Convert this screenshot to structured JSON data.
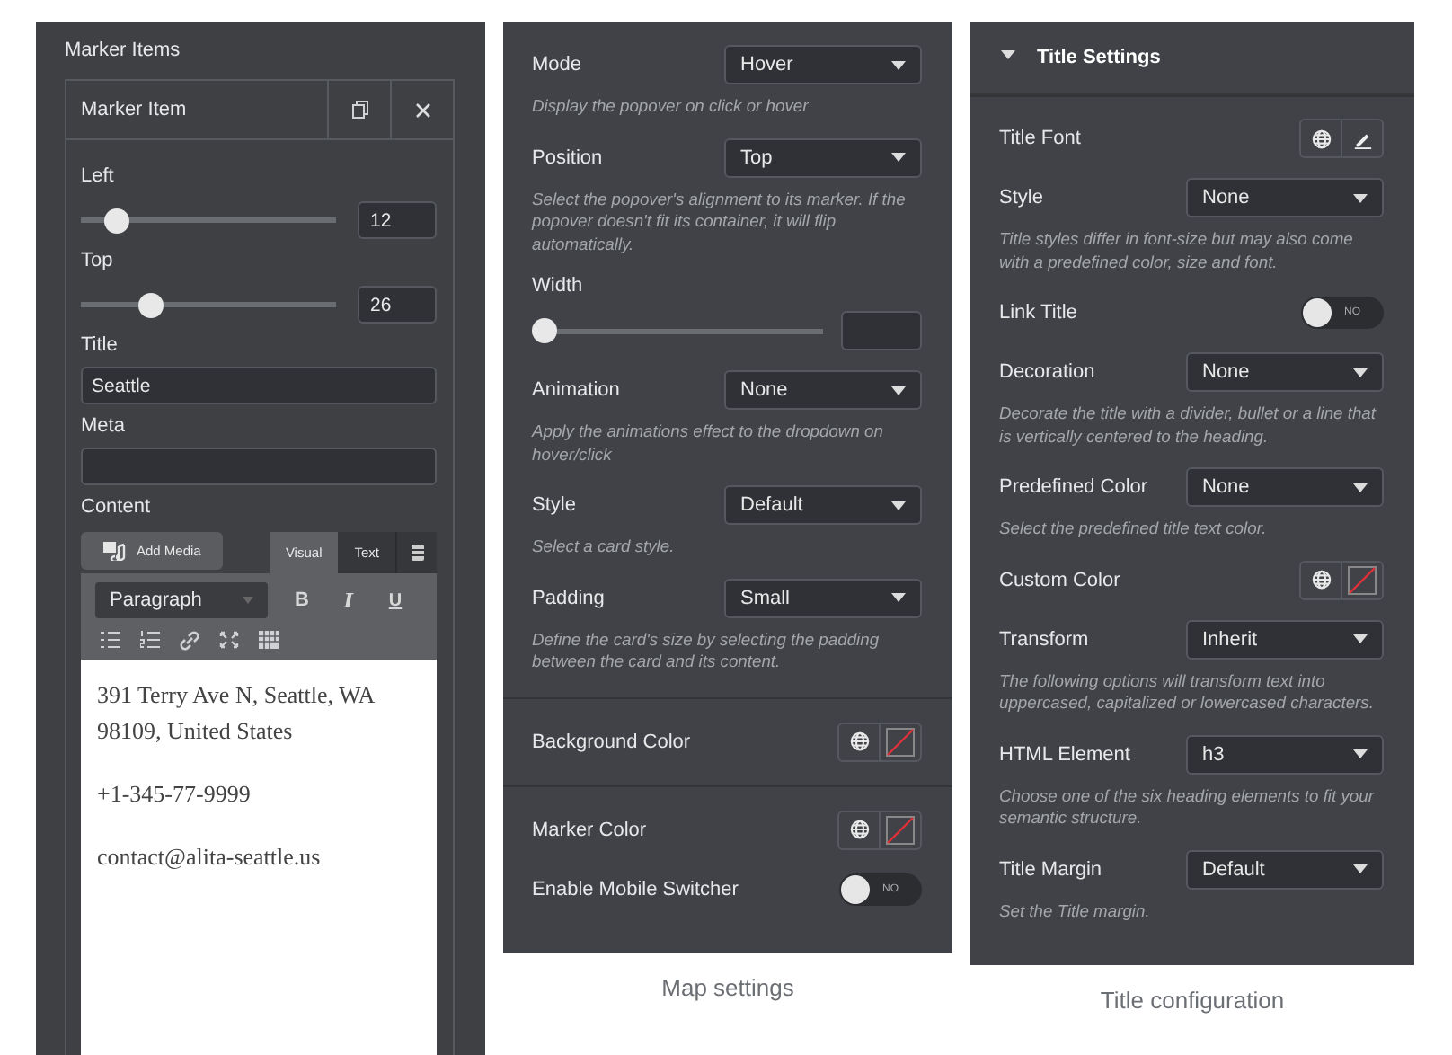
{
  "marker_items": {
    "heading": "Marker Items",
    "item": {
      "title": "Marker Item",
      "fields": [
        {
          "kind": "slider",
          "label": "Left",
          "level": 0.1,
          "value": "12"
        },
        {
          "kind": "slider",
          "label": "Top",
          "level": 0.25,
          "value": "26"
        },
        {
          "kind": "text",
          "label": "Title",
          "value": "Seattle"
        },
        {
          "kind": "text",
          "label": "Meta"
        }
      ],
      "content": {
        "label": "Content",
        "add_media": "Add Media",
        "tabs": [
          {
            "label": "Visual",
            "selected": true
          },
          {
            "label": "Text",
            "selected": false
          }
        ],
        "format": "Paragraph",
        "format_buttons": [
          "B",
          "I",
          "U"
        ],
        "paragraphs": [
          "391 Terry Ave N, Seattle, WA 98109, United States",
          "+1-345-77-9999",
          "contact@alita-seattle.us"
        ]
      }
    }
  },
  "map_settings": {
    "sections": [
      {
        "controls": [
          {
            "kind": "select",
            "label": "Mode",
            "value": "Hover",
            "description": "Display the popover on click or hover"
          },
          {
            "kind": "select",
            "label": "Position",
            "value": "Top",
            "description": "Select the popover's alignment to its marker. If the popover doesn't fit its container, it will flip automatically."
          },
          {
            "kind": "slider",
            "label": "Width",
            "level": 0
          },
          {
            "kind": "select",
            "label": "Animation",
            "value": "None",
            "description": "Apply the animations effect to the dropdown on hover/click"
          },
          {
            "kind": "select",
            "label": "Style",
            "value": "Default",
            "description": "Select a card style."
          },
          {
            "kind": "select",
            "label": "Padding",
            "value": "Small",
            "description": "Define the card's size by selecting the padding between the card and its content."
          }
        ]
      },
      {
        "controls": [
          {
            "kind": "color",
            "label": "Background Color"
          }
        ]
      },
      {
        "controls": [
          {
            "kind": "color",
            "label": "Marker Color"
          },
          {
            "kind": "toggle",
            "label": "Enable Mobile Switcher",
            "on": false,
            "text": "NO"
          }
        ]
      }
    ],
    "caption": "Map settings"
  },
  "title_configuration": {
    "header": {
      "title": "Title Settings",
      "expanded": true
    },
    "sections": [
      {
        "controls": [
          {
            "kind": "font",
            "label": "Title Font"
          },
          {
            "kind": "select",
            "label": "Style",
            "value": "None",
            "description": "Title styles differ in font-size but may also come with a predefined color, size and font."
          },
          {
            "kind": "toggle",
            "label": "Link Title",
            "on": false,
            "text": "NO"
          },
          {
            "kind": "select",
            "label": "Decoration",
            "value": "None",
            "description": "Decorate the title with a divider, bullet or a line that is vertically centered to the heading."
          },
          {
            "kind": "select",
            "label": "Predefined Color",
            "value": "None",
            "description": "Select the predefined title text color."
          },
          {
            "kind": "color",
            "label": "Custom Color"
          },
          {
            "kind": "select",
            "label": "Transform",
            "value": "Inherit",
            "description": "The following options will transform text into uppercased, capitalized or lowercased characters."
          },
          {
            "kind": "select",
            "label": "HTML Element",
            "value": "h3",
            "description": "Choose one of the six heading elements to fit your semantic structure."
          },
          {
            "kind": "select",
            "label": "Title Margin",
            "value": "Default",
            "description": "Set the Title margin."
          }
        ]
      }
    ],
    "caption": "Title configuration"
  }
}
